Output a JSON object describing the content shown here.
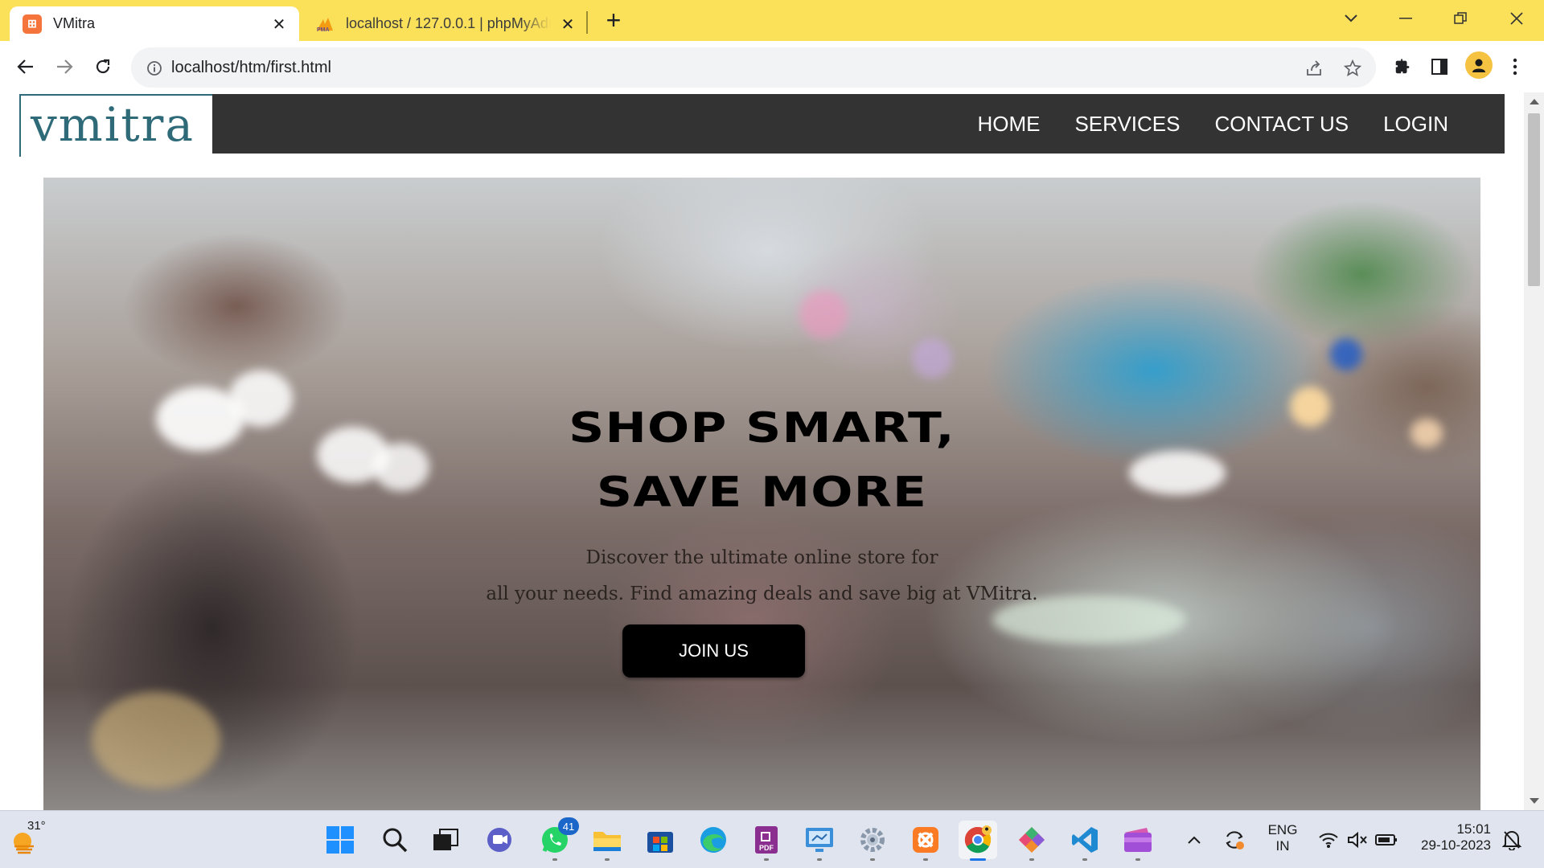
{
  "browser": {
    "tabs": [
      {
        "title": "VMitra",
        "active": true
      },
      {
        "title": "localhost / 127.0.0.1 | phpMyAdmin",
        "active": false
      }
    ],
    "url": "localhost/htm/first.html",
    "accent_color": "#fbe05a"
  },
  "page": {
    "logo": "vmitra",
    "nav": [
      "HOME",
      "SERVICES",
      "CONTACT US",
      "LOGIN"
    ],
    "hero": {
      "headline_line1": "SHOP SMART,",
      "headline_line2": "SAVE MORE",
      "tagline_line1": "Discover the ultimate online store for",
      "tagline_line2": "all your needs. Find amazing deals and save big at VMitra.",
      "cta": "JOIN US"
    }
  },
  "taskbar": {
    "weather": "31°",
    "apps": [
      "windows-start",
      "search",
      "task-view",
      "teams-chat",
      "whatsapp",
      "file-explorer",
      "microsoft-store",
      "edge",
      "pdf-editor",
      "screen-capture",
      "settings",
      "xampp",
      "chrome",
      "git-tool",
      "vscode",
      "media-player"
    ],
    "whatsapp_badge": "41",
    "language_line1": "ENG",
    "language_line2": "IN",
    "time": "15:01",
    "date": "29-10-2023"
  }
}
